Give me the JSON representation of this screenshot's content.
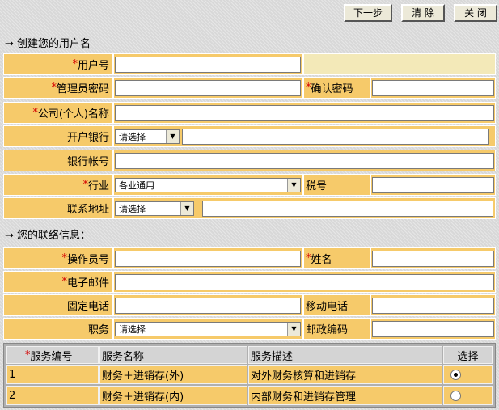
{
  "toolbar": {
    "next_label": "下一步",
    "clear_label": "清 除",
    "close_label": "关 闭"
  },
  "sections": {
    "account": "创建您的用户名",
    "contact": "您的联络信息：",
    "arrow": "→"
  },
  "required_mark": "*",
  "labels": {
    "username": "用户号",
    "admin_password": "管理员密码",
    "confirm_password": "确认密码",
    "company_name": "公司(个人)名称",
    "bank": "开户银行",
    "bank_account": "银行帐号",
    "industry": "行业",
    "tax_no": "税号",
    "address": "联系地址",
    "operator_no": "操作员号",
    "name": "姓名",
    "email": "电子邮件",
    "phone": "固定电话",
    "mobile": "移动电话",
    "position": "职务",
    "postcode": "邮政编码"
  },
  "selects": {
    "bank": "请选择",
    "industry": "各业通用",
    "address": "请选择",
    "position": "请选择"
  },
  "service_table": {
    "headers": [
      "服务编号",
      "服务名称",
      "服务描述",
      "选择"
    ],
    "rows": [
      {
        "id": "1",
        "name": "财务＋进销存(外)",
        "desc": "对外财务核算和进销存",
        "selected": true
      },
      {
        "id": "2",
        "name": "财务＋进销存(内)",
        "desc": "内部财务和进销存管理",
        "selected": false
      }
    ]
  }
}
